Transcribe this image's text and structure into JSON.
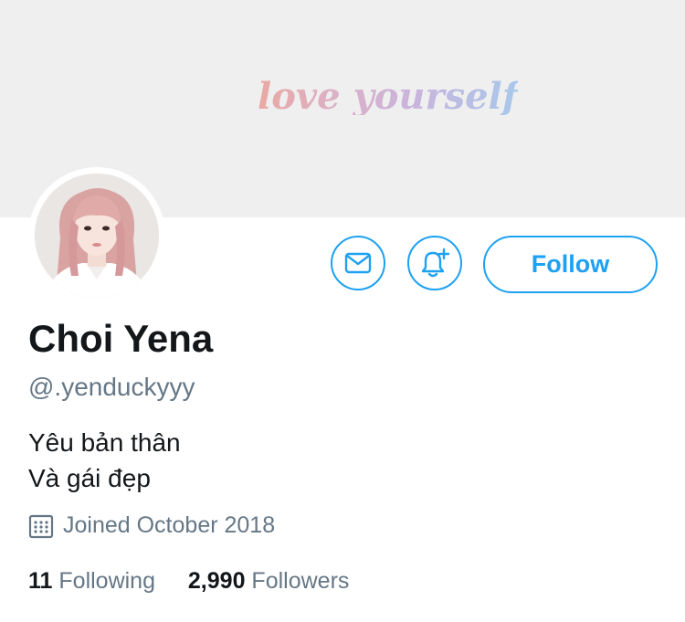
{
  "banner": {
    "text": "love yourself"
  },
  "profile": {
    "name": "Choi Yena",
    "handle": "@.yenduckyyy",
    "bio_lines": [
      "Yêu bản thân",
      "Và gái đẹp"
    ],
    "joined": "Joined October 2018"
  },
  "actions": {
    "message_icon": "envelope-icon",
    "notify_icon": "bell-plus-icon",
    "follow_label": "Follow"
  },
  "stats": {
    "following_count": "11",
    "following_label": "Following",
    "followers_count": "2,990",
    "followers_label": "Followers"
  },
  "colors": {
    "accent": "#1da1f2",
    "secondary_text": "#657786",
    "primary_text": "#14171a",
    "banner_bg": "#efefef"
  }
}
